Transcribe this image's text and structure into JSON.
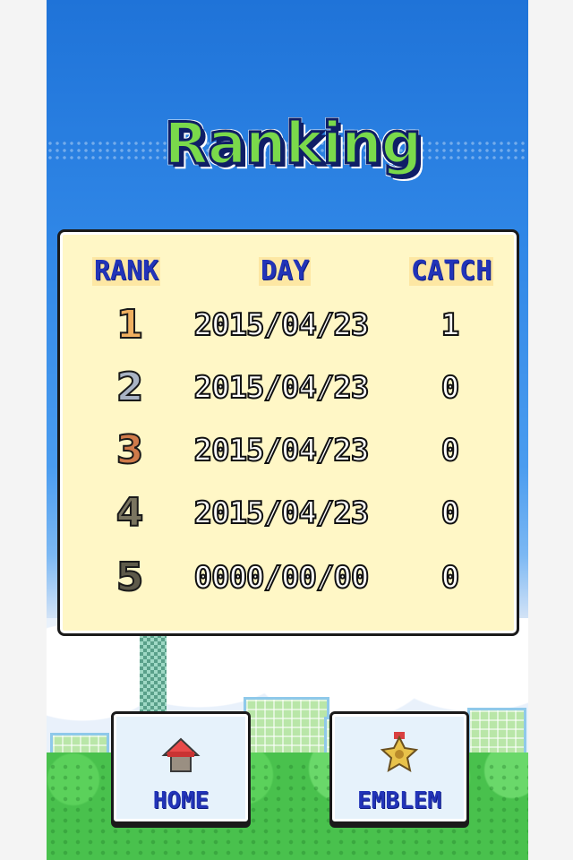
{
  "title": "Ranking",
  "table": {
    "headers": {
      "rank": "RANK",
      "day": "DAY",
      "catch": "CATCH"
    },
    "rows": [
      {
        "rank": "1",
        "day": "2015/04/23",
        "catch": "1",
        "rank_color": "#f0b060"
      },
      {
        "rank": "2",
        "day": "2015/04/23",
        "catch": "0",
        "rank_color": "#a9b3c4"
      },
      {
        "rank": "3",
        "day": "2015/04/23",
        "catch": "0",
        "rank_color": "#d07a4a"
      },
      {
        "rank": "4",
        "day": "2015/04/23",
        "catch": "0",
        "rank_color": "#7a7560"
      },
      {
        "rank": "5",
        "day": "0000/00/00",
        "catch": "0",
        "rank_color": "#5e5a4a"
      }
    ]
  },
  "buttons": {
    "home": {
      "label": "HOME",
      "icon": "house-icon"
    },
    "emblem": {
      "label": "EMBLEM",
      "icon": "medal-icon"
    }
  },
  "colors": {
    "sky": "#2f86e6",
    "panel": "#fff7c6",
    "header_text": "#2234b8",
    "title_fill": "#7ad94b"
  }
}
